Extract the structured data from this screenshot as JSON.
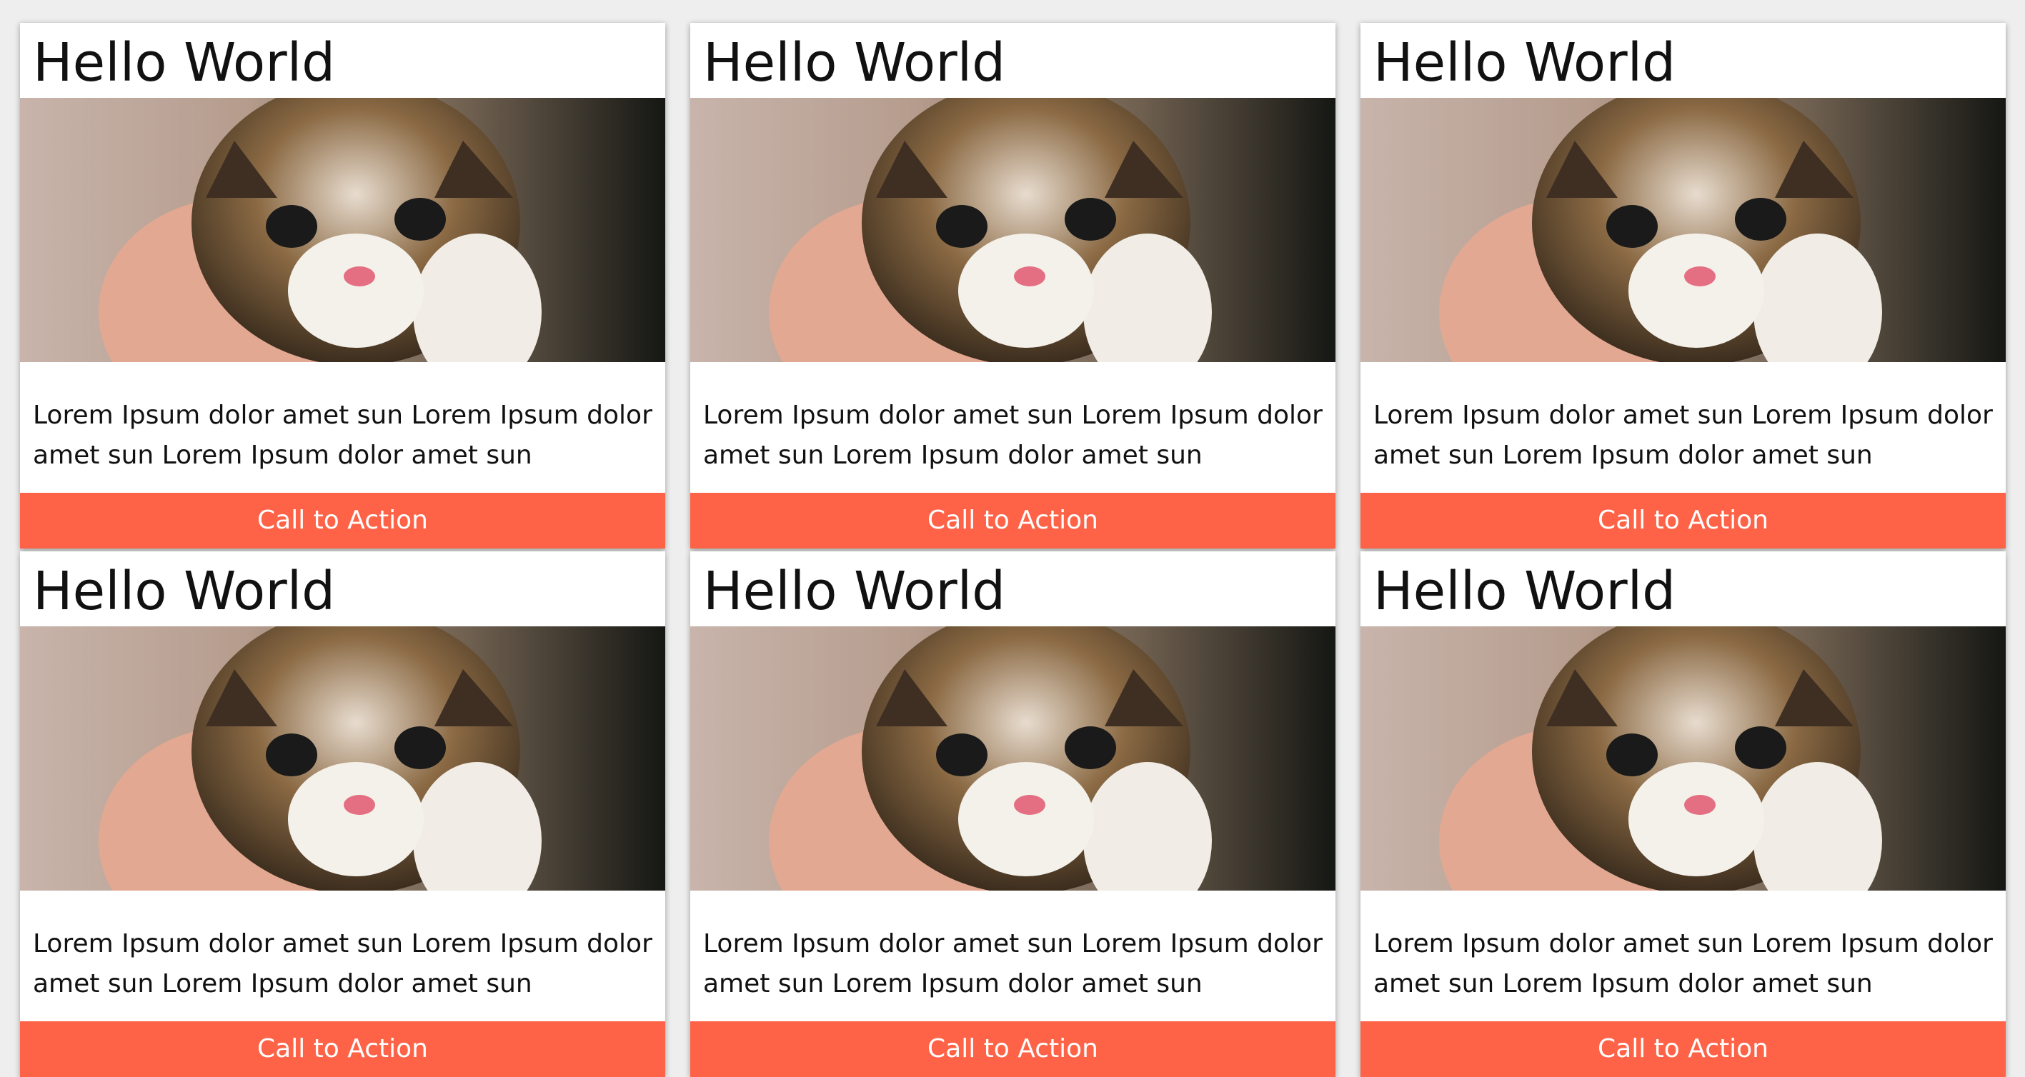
{
  "cards": [
    {
      "title": "Hello World",
      "image_alt": "kitten-photo",
      "body": "Lorem Ipsum dolor amet sun Lorem Ipsum dolor amet sun Lorem Ipsum dolor amet sun",
      "cta_label": "Call to Action"
    },
    {
      "title": "Hello World",
      "image_alt": "kitten-photo",
      "body": "Lorem Ipsum dolor amet sun Lorem Ipsum dolor amet sun Lorem Ipsum dolor amet sun",
      "cta_label": "Call to Action"
    },
    {
      "title": "Hello World",
      "image_alt": "kitten-photo",
      "body": "Lorem Ipsum dolor amet sun Lorem Ipsum dolor amet sun Lorem Ipsum dolor amet sun",
      "cta_label": "Call to Action"
    },
    {
      "title": "Hello World",
      "image_alt": "kitten-photo",
      "body": "Lorem Ipsum dolor amet sun Lorem Ipsum dolor amet sun Lorem Ipsum dolor amet sun",
      "cta_label": "Call to Action"
    },
    {
      "title": "Hello World",
      "image_alt": "kitten-photo",
      "body": "Lorem Ipsum dolor amet sun Lorem Ipsum dolor amet sun Lorem Ipsum dolor amet sun",
      "cta_label": "Call to Action"
    },
    {
      "title": "Hello World",
      "image_alt": "kitten-photo",
      "body": "Lorem Ipsum dolor amet sun Lorem Ipsum dolor amet sun Lorem Ipsum dolor amet sun",
      "cta_label": "Call to Action"
    }
  ],
  "colors": {
    "page_background": "#eeeeee",
    "card_background": "#ffffff",
    "cta_background": "#ff6347",
    "cta_text": "#ffffff",
    "text": "#111111"
  }
}
